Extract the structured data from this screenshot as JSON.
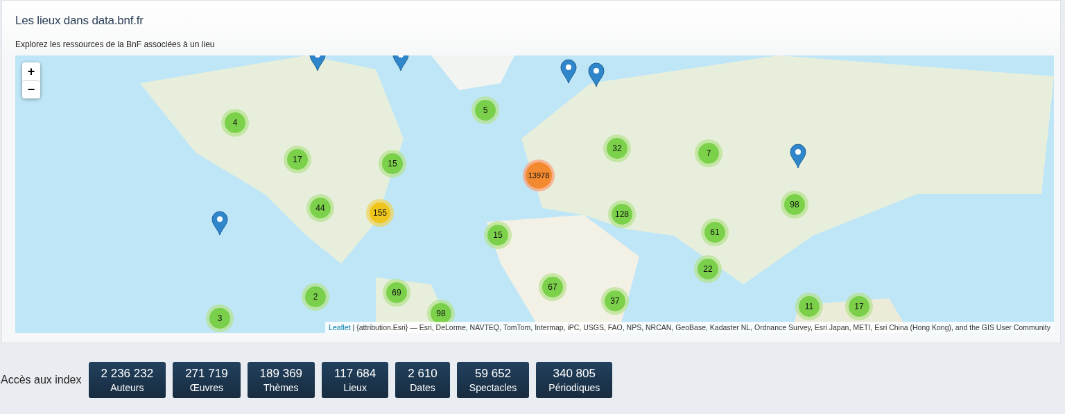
{
  "header": {
    "title": "Les lieux dans data.bnf.fr",
    "subtitle": "Explorez les ressources de la BnF associées à un lieu"
  },
  "map": {
    "zoom_in": "+",
    "zoom_out": "−",
    "clusters": [
      {
        "count": "4",
        "kind": "small"
      },
      {
        "count": "17",
        "kind": "small"
      },
      {
        "count": "15",
        "kind": "small"
      },
      {
        "count": "5",
        "kind": "small"
      },
      {
        "count": "44",
        "kind": "small"
      },
      {
        "count": "155",
        "kind": "medium"
      },
      {
        "count": "13978",
        "kind": "large"
      },
      {
        "count": "32",
        "kind": "small"
      },
      {
        "count": "7",
        "kind": "small"
      },
      {
        "count": "128",
        "kind": "small"
      },
      {
        "count": "15",
        "kind": "small"
      },
      {
        "count": "61",
        "kind": "small"
      },
      {
        "count": "98",
        "kind": "small"
      },
      {
        "count": "22",
        "kind": "small"
      },
      {
        "count": "67",
        "kind": "small"
      },
      {
        "count": "37",
        "kind": "small"
      },
      {
        "count": "2",
        "kind": "small"
      },
      {
        "count": "69",
        "kind": "small"
      },
      {
        "count": "98",
        "kind": "small"
      },
      {
        "count": "3",
        "kind": "small"
      },
      {
        "count": "11",
        "kind": "small"
      },
      {
        "count": "17",
        "kind": "small"
      }
    ],
    "attribution": {
      "link": "Leaflet",
      "text": "| {attribution.Esri} — Esri, DeLorme, NAVTEQ, TomTom, Intermap, iPC, USGS, FAO, NPS, NRCAN, GeoBase, Kadaster NL, Ordnance Survey, Esri Japan, METI, Esri China (Hong Kong), and the GIS User Community"
    }
  },
  "index": {
    "label": "Accès aux index",
    "buttons": [
      {
        "count": "2 236 232",
        "label": "Auteurs"
      },
      {
        "count": "271 719",
        "label": "Œuvres"
      },
      {
        "count": "189 369",
        "label": "Thèmes"
      },
      {
        "count": "117 684",
        "label": "Lieux"
      },
      {
        "count": "2 610",
        "label": "Dates"
      },
      {
        "count": "59 652",
        "label": "Spectacles"
      },
      {
        "count": "340 805",
        "label": "Périodiques"
      }
    ]
  }
}
